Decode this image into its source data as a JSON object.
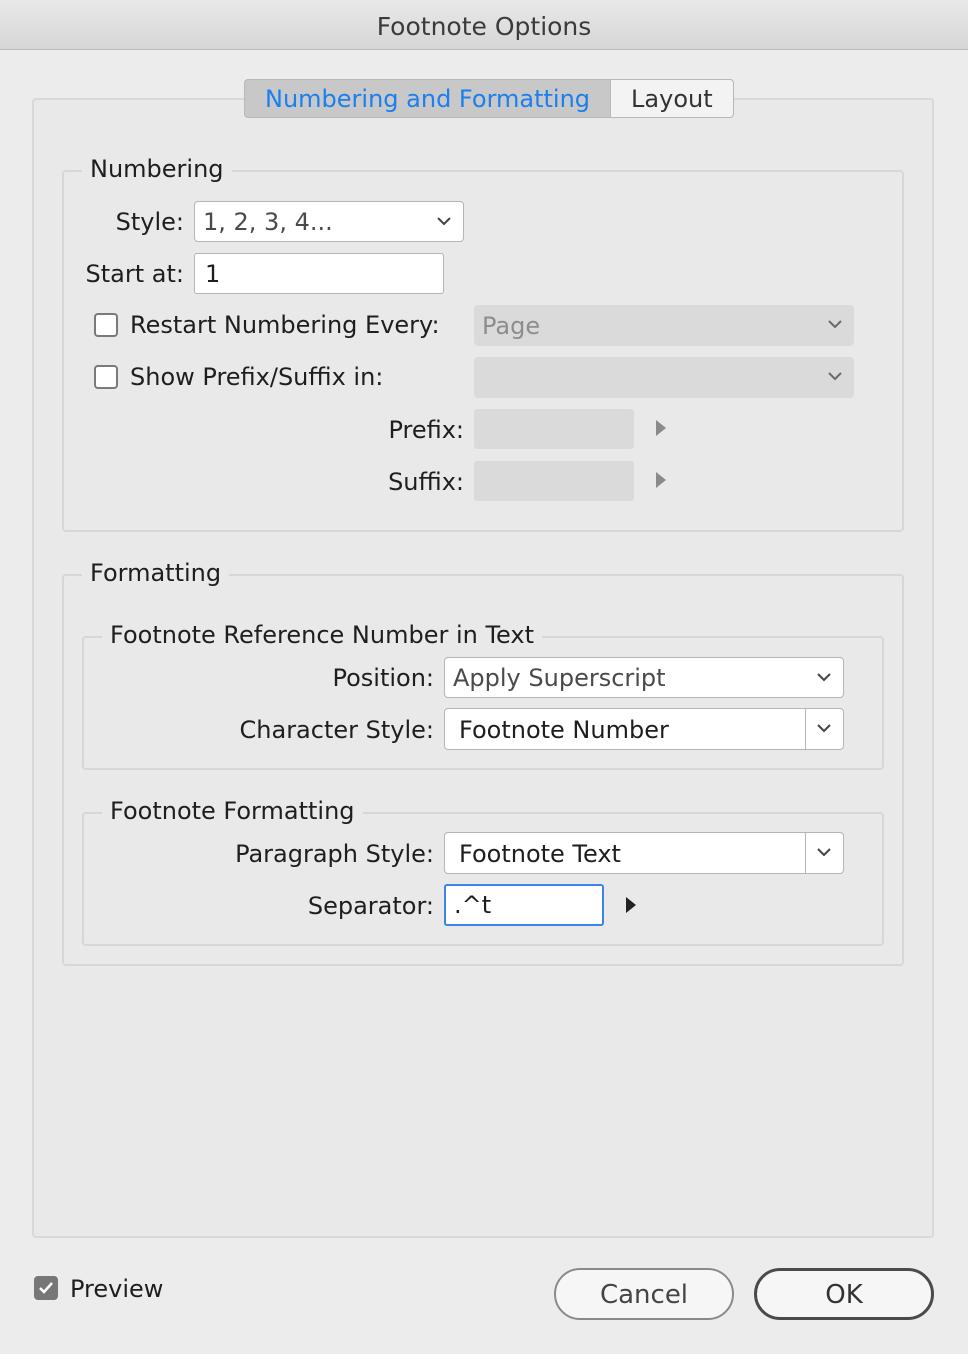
{
  "window": {
    "title": "Footnote Options"
  },
  "tabs": {
    "active": "Numbering and Formatting",
    "inactive": "Layout"
  },
  "numbering": {
    "legend": "Numbering",
    "style_label": "Style:",
    "style_value": "1, 2, 3, 4...",
    "start_label": "Start at:",
    "start_value": "1",
    "restart_label": "Restart Numbering Every:",
    "restart_checked": false,
    "restart_value": "Page",
    "prefix_suffix_label": "Show Prefix/Suffix in:",
    "prefix_suffix_checked": false,
    "prefix_suffix_value": "",
    "prefix_label": "Prefix:",
    "prefix_value": "",
    "suffix_label": "Suffix:",
    "suffix_value": ""
  },
  "formatting": {
    "legend": "Formatting",
    "reference": {
      "legend": "Footnote Reference Number in Text",
      "position_label": "Position:",
      "position_value": "Apply Superscript",
      "char_style_label": "Character Style:",
      "char_style_value": "Footnote Number"
    },
    "footnote": {
      "legend": "Footnote Formatting",
      "para_style_label": "Paragraph Style:",
      "para_style_value": "Footnote Text",
      "separator_label": "Separator:",
      "separator_value": ".^t"
    }
  },
  "footer": {
    "preview_label": "Preview",
    "preview_checked": true,
    "cancel_label": "Cancel",
    "ok_label": "OK"
  },
  "colors": {
    "accent": "#1a7ff0",
    "focus": "#3c85e6",
    "background": "#ececec"
  },
  "icons": [
    "chevron-down-icon",
    "checkmark-icon",
    "triangle-right-icon"
  ]
}
